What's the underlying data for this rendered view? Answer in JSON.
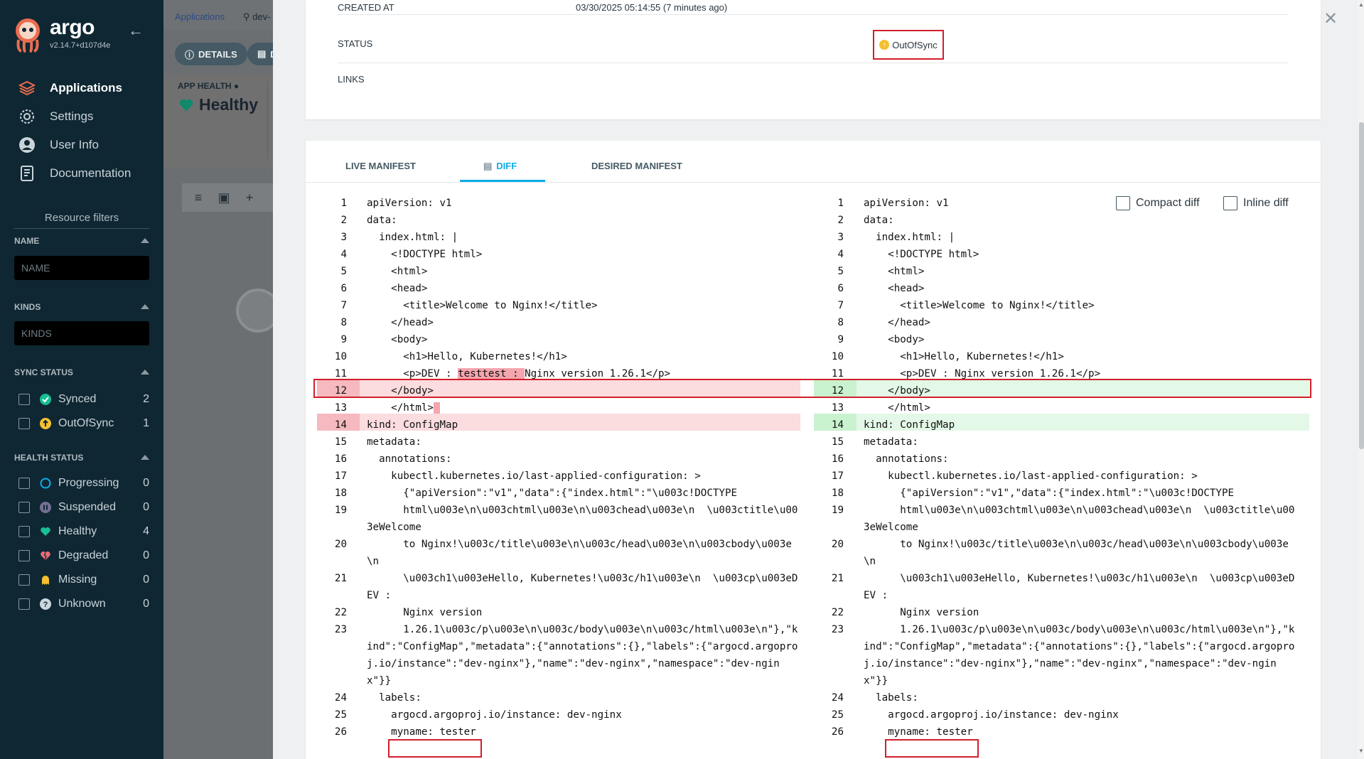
{
  "brand": {
    "name": "argo",
    "version": "v2.14.7+d107d4e"
  },
  "nav": [
    {
      "label": "Applications",
      "icon": "layers-icon"
    },
    {
      "label": "Settings",
      "icon": "gear-icon"
    },
    {
      "label": "User Info",
      "icon": "user-icon"
    },
    {
      "label": "Documentation",
      "icon": "book-icon"
    }
  ],
  "filters": {
    "title": "Resource filters",
    "name_label": "NAME",
    "name_placeholder": "NAME",
    "kinds_label": "KINDS",
    "kinds_placeholder": "KINDS",
    "sync_label": "SYNC STATUS",
    "sync": [
      {
        "label": "Synced",
        "count": "2",
        "color": "#18be94"
      },
      {
        "label": "OutOfSync",
        "count": "1",
        "color": "#f4c030"
      }
    ],
    "health_label": "HEALTH STATUS",
    "health": [
      {
        "label": "Progressing",
        "count": "0",
        "color": "#0dadea"
      },
      {
        "label": "Suspended",
        "count": "0",
        "color": "#766f94"
      },
      {
        "label": "Healthy",
        "count": "4",
        "color": "#18be94"
      },
      {
        "label": "Degraded",
        "count": "0",
        "color": "#e96d76"
      },
      {
        "label": "Missing",
        "count": "0",
        "color": "#f4c030"
      },
      {
        "label": "Unknown",
        "count": "0",
        "color": "#ccd6dd"
      }
    ]
  },
  "app": {
    "breadcrumb": "Applications",
    "breadcrumb_current": "dev-",
    "details_button": "DETAILS",
    "diff_button": "D",
    "health_label": "APP HEALTH",
    "health_value": "Healthy"
  },
  "info": {
    "created_label": "CREATED AT",
    "created_value": "03/30/2025 05:14:55  (7 minutes ago)",
    "status_label": "STATUS",
    "status_value": "OutOfSync",
    "links_label": "LINKS"
  },
  "tabs": {
    "live": "LIVE MANIFEST",
    "diff": "DIFF",
    "desired": "DESIRED MANIFEST"
  },
  "options": {
    "compact": "Compact diff",
    "inline": "Inline diff"
  },
  "diff": {
    "left": [
      {
        "n": "1",
        "t": "apiVersion: v1"
      },
      {
        "n": "2",
        "t": "data:"
      },
      {
        "n": "3",
        "t": "  index.html: |"
      },
      {
        "n": "4",
        "t": "    <!DOCTYPE html>"
      },
      {
        "n": "5",
        "t": "    <html>"
      },
      {
        "n": "6",
        "t": "    <head>"
      },
      {
        "n": "7",
        "t": "      <title>Welcome to Nginx!</title>"
      },
      {
        "n": "8",
        "t": "    </head>"
      },
      {
        "n": "9",
        "t": "    <body>"
      },
      {
        "n": "10",
        "t": "      <h1>Hello, Kubernetes!</h1>"
      },
      {
        "n": "11",
        "t": "      <p>DEV : testtest : Nginx version 1.26.1</p>"
      },
      {
        "n": "12",
        "t": "    </body>"
      },
      {
        "n": "13",
        "t": "    </html>"
      },
      {
        "n": "14",
        "t": "kind: ConfigMap"
      },
      {
        "n": "15",
        "t": "metadata:"
      },
      {
        "n": "16",
        "t": "  annotations:"
      },
      {
        "n": "17",
        "t": "    kubectl.kubernetes.io/last-applied-configuration: >"
      },
      {
        "n": "18",
        "t": "      {\"apiVersion\":\"v1\",\"data\":{\"index.html\":\"\\u003c!DOCTYPE"
      },
      {
        "n": "19",
        "t": "      html\\u003e\\n\\u003chtml\\u003e\\n\\u003chead\\u003e\\n  \\u003ctitle\\u00"
      },
      {
        "n": "",
        "t": "3eWelcome"
      },
      {
        "n": "20",
        "t": "      to Nginx!\\u003c/title\\u003e\\n\\u003c/head\\u003e\\n\\u003cbody\\u003e"
      },
      {
        "n": "",
        "t": "\\n"
      },
      {
        "n": "21",
        "t": "      \\u003ch1\\u003eHello, Kubernetes!\\u003c/h1\\u003e\\n  \\u003cp\\u003eD"
      },
      {
        "n": "",
        "t": "EV :"
      },
      {
        "n": "22",
        "t": "      Nginx version"
      },
      {
        "n": "23",
        "t": "      1.26.1\\u003c/p\\u003e\\n\\u003c/body\\u003e\\n\\u003c/html\\u003e\\n\"},\"k"
      },
      {
        "n": "",
        "t": "ind\":\"ConfigMap\",\"metadata\":{\"annotations\":{},\"labels\":{\"argocd.argopro"
      },
      {
        "n": "",
        "t": "j.io/instance\":\"dev-nginx\"},\"name\":\"dev-nginx\",\"namespace\":\"dev-ngin"
      },
      {
        "n": "",
        "t": "x\"}}"
      },
      {
        "n": "24",
        "t": "  labels:"
      },
      {
        "n": "25",
        "t": "    argocd.argoproj.io/instance: dev-nginx"
      },
      {
        "n": "26",
        "t": "    myname: tester"
      }
    ],
    "right": [
      {
        "n": "1",
        "t": "apiVersion: v1"
      },
      {
        "n": "2",
        "t": "data:"
      },
      {
        "n": "3",
        "t": "  index.html: |"
      },
      {
        "n": "4",
        "t": "    <!DOCTYPE html>"
      },
      {
        "n": "5",
        "t": "    <html>"
      },
      {
        "n": "6",
        "t": "    <head>"
      },
      {
        "n": "7",
        "t": "      <title>Welcome to Nginx!</title>"
      },
      {
        "n": "8",
        "t": "    </head>"
      },
      {
        "n": "9",
        "t": "    <body>"
      },
      {
        "n": "10",
        "t": "      <h1>Hello, Kubernetes!</h1>"
      },
      {
        "n": "11",
        "t": "      <p>DEV : Nginx version 1.26.1</p>"
      },
      {
        "n": "12",
        "t": "    </body>"
      },
      {
        "n": "13",
        "t": "    </html>"
      },
      {
        "n": "14",
        "t": "kind: ConfigMap"
      },
      {
        "n": "15",
        "t": "metadata:"
      },
      {
        "n": "16",
        "t": "  annotations:"
      },
      {
        "n": "17",
        "t": "    kubectl.kubernetes.io/last-applied-configuration: >"
      },
      {
        "n": "18",
        "t": "      {\"apiVersion\":\"v1\",\"data\":{\"index.html\":\"\\u003c!DOCTYPE"
      },
      {
        "n": "19",
        "t": "      html\\u003e\\n\\u003chtml\\u003e\\n\\u003chead\\u003e\\n  \\u003ctitle\\u00"
      },
      {
        "n": "",
        "t": "3eWelcome"
      },
      {
        "n": "20",
        "t": "      to Nginx!\\u003c/title\\u003e\\n\\u003c/head\\u003e\\n\\u003cbody\\u003e"
      },
      {
        "n": "",
        "t": "\\n"
      },
      {
        "n": "21",
        "t": "      \\u003ch1\\u003eHello, Kubernetes!\\u003c/h1\\u003e\\n  \\u003cp\\u003eD"
      },
      {
        "n": "",
        "t": "EV :"
      },
      {
        "n": "22",
        "t": "      Nginx version"
      },
      {
        "n": "23",
        "t": "      1.26.1\\u003c/p\\u003e\\n\\u003c/body\\u003e\\n\\u003c/html\\u003e\\n\"},\"k"
      },
      {
        "n": "",
        "t": "ind\":\"ConfigMap\",\"metadata\":{\"annotations\":{},\"labels\":{\"argocd.argopro"
      },
      {
        "n": "",
        "t": "j.io/instance\":\"dev-nginx\"},\"name\":\"dev-nginx\",\"namespace\":\"dev-ngin"
      },
      {
        "n": "",
        "t": "x\"}}"
      },
      {
        "n": "24",
        "t": "  labels:"
      },
      {
        "n": "25",
        "t": "    argocd.argoproj.io/instance: dev-nginx"
      },
      {
        "n": "26",
        "t": "    myname: tester"
      }
    ]
  }
}
